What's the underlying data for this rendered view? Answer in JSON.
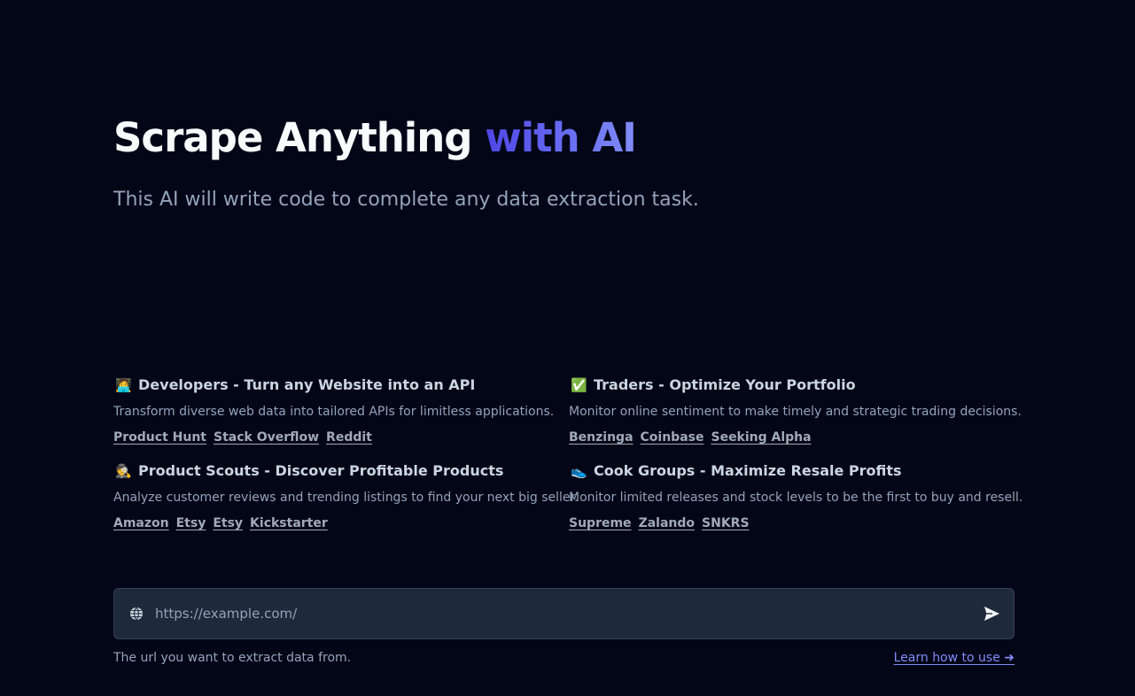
{
  "hero": {
    "title_main": "Scrape Anything ",
    "title_accent": "with AI",
    "subtitle": "This AI will write code to complete any data extraction task."
  },
  "use_cases": [
    {
      "emoji": "🧑‍💻",
      "title": "Developers - Turn any Website into an API",
      "description": "Transform diverse web data into tailored APIs for limitless applications.",
      "links": [
        "Product Hunt",
        "Stack Overflow",
        "Reddit"
      ]
    },
    {
      "emoji": "✅",
      "title": "Traders - Optimize Your Portfolio",
      "description": "Monitor online sentiment to make timely and strategic trading decisions.",
      "links": [
        "Benzinga",
        "Coinbase",
        "Seeking Alpha"
      ]
    },
    {
      "emoji": "🕵️",
      "title": "Product Scouts - Discover Profitable Products",
      "description": "Analyze customer reviews and trending listings to find your next big seller.",
      "links": [
        "Amazon",
        "Etsy",
        "Etsy",
        "Kickstarter"
      ]
    },
    {
      "emoji": "👟",
      "title": "Cook Groups - Maximize Resale Profits",
      "description": "Monitor limited releases and stock levels to be the first to buy and resell.",
      "links": [
        "Supreme",
        "Zalando",
        "SNKRS"
      ]
    }
  ],
  "url_input": {
    "value": "",
    "placeholder": "https://example.com/",
    "icon": "globe-icon",
    "submit_icon": "send-icon"
  },
  "helper_text": "The url you want to extract data from.",
  "learn_link": "Learn how to use ➜",
  "colors": {
    "background": "#030617",
    "accent_start": "#4f46e5",
    "accent_end": "#818cf8",
    "input_bg": "#1e293b"
  }
}
